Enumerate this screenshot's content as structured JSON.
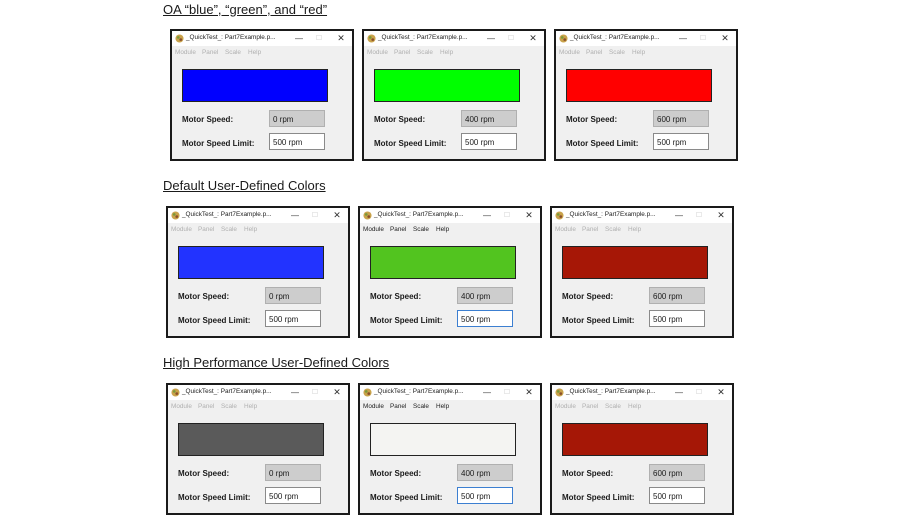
{
  "sections": [
    {
      "heading": "OA “blue”, “green”, and “red”",
      "windows": [
        {
          "swatch_color": "#0000ff",
          "speed": "0 rpm",
          "limit": "500 rpm",
          "menu_active": false,
          "limit_focused": false
        },
        {
          "swatch_color": "#00ff00",
          "speed": "400 rpm",
          "limit": "500 rpm",
          "menu_active": false,
          "limit_focused": false
        },
        {
          "swatch_color": "#ff0000",
          "speed": "600 rpm",
          "limit": "500 rpm",
          "menu_active": false,
          "limit_focused": false
        }
      ]
    },
    {
      "heading": "Default User-Defined Colors",
      "windows": [
        {
          "swatch_color": "#2233ff",
          "speed": "0 rpm",
          "limit": "500 rpm",
          "menu_active": false,
          "limit_focused": false
        },
        {
          "swatch_color": "#52c41f",
          "speed": "400 rpm",
          "limit": "500 rpm",
          "menu_active": true,
          "limit_focused": true
        },
        {
          "swatch_color": "#a61706",
          "speed": "600 rpm",
          "limit": "500 rpm",
          "menu_active": false,
          "limit_focused": false
        }
      ]
    },
    {
      "heading": "High Performance User-Defined Colors",
      "windows": [
        {
          "swatch_color": "#5a5a5a",
          "speed": "0 rpm",
          "limit": "500 rpm",
          "menu_active": false,
          "limit_focused": false
        },
        {
          "swatch_color": "#f4f4f2",
          "speed": "400 rpm",
          "limit": "500 rpm",
          "menu_active": true,
          "limit_focused": true
        },
        {
          "swatch_color": "#a51706",
          "speed": "600 rpm",
          "limit": "500 rpm",
          "menu_active": false,
          "limit_focused": false
        }
      ]
    }
  ],
  "window": {
    "title": "_QuickTest_: Part7Example.p...",
    "minimize": "—",
    "maximize": "☐",
    "close": "✕",
    "icon": "app-icon",
    "menu": [
      "Module",
      "Panel",
      "Scale",
      "Help"
    ],
    "motor_speed_label": "Motor Speed:",
    "motor_speed_limit_label": "Motor Speed Limit:"
  }
}
